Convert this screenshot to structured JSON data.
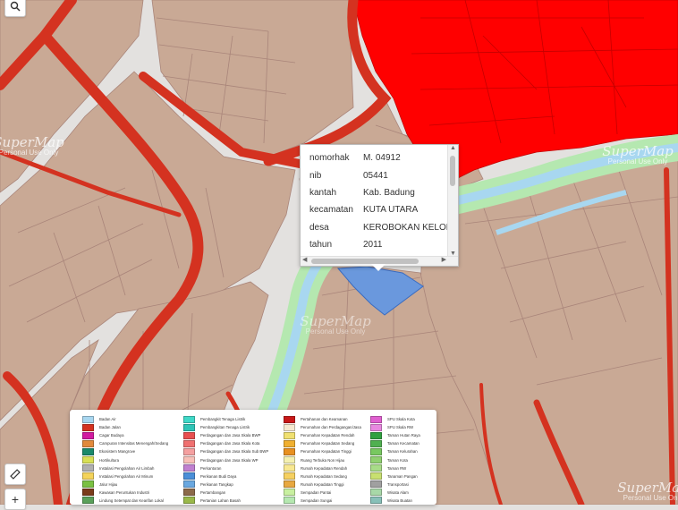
{
  "popup": {
    "rows": [
      {
        "key": "nomorhak",
        "value": "M. 04912"
      },
      {
        "key": "nib",
        "value": "05441"
      },
      {
        "key": "kantah",
        "value": "Kab. Badung"
      },
      {
        "key": "kecamatan",
        "value": "KUTA UTARA"
      },
      {
        "key": "desa",
        "value": "KEROBOKAN KELOD"
      },
      {
        "key": "tahun",
        "value": "2011"
      }
    ]
  },
  "controls": {
    "search_icon": "search-icon",
    "ruler_icon": "ruler-icon",
    "zoom_in_label": "+"
  },
  "watermark": {
    "brand": "SuperMap",
    "note": "Personal Use Only"
  },
  "colors": {
    "land": "#c9a995",
    "road": "#d43220",
    "commercial": "#ff0000",
    "river_buffer": "#b5e8b0",
    "river": "#a8d7f0",
    "selected_parcel": "#6a98dd"
  },
  "legend": {
    "col1": [
      {
        "label": "Badan Air",
        "color": "#a8d7f0"
      },
      {
        "label": "Badan Jalan",
        "color": "#d43220"
      },
      {
        "label": "Cagar Budaya",
        "color": "#d21aa0"
      },
      {
        "label": "Campuran Intensitas Menengah/Sedang",
        "color": "#e28a3c"
      },
      {
        "label": "Ekosistem Mangrove",
        "color": "#1a8a6a"
      },
      {
        "label": "Hortikultura",
        "color": "#d8e055"
      },
      {
        "label": "Instalasi Pengolahan Air Limbah",
        "color": "#b0b0b0"
      },
      {
        "label": "Instalasi Pengolahan Air Minum",
        "color": "#f4d35a"
      },
      {
        "label": "Jalur Hijau",
        "color": "#7ac142"
      },
      {
        "label": "Kawasan Peruntukan Industri",
        "color": "#7a3b1a"
      },
      {
        "label": "Lindung Setempat dan Kearifan Lokal",
        "color": "#5aa05a"
      }
    ],
    "col2": [
      {
        "label": "Pembangkit Tenaga Listrik",
        "color": "#3fd9c8"
      },
      {
        "label": "Pembangkitan Tenaga Listrik",
        "color": "#2ec4b6"
      },
      {
        "label": "Perdagangan dan Jasa Skala BWP",
        "color": "#e85050"
      },
      {
        "label": "Perdagangan dan Jasa Skala Kota",
        "color": "#f07070"
      },
      {
        "label": "Perdagangan dan Jasa Skala Sub BWP",
        "color": "#f5a0a0"
      },
      {
        "label": "Perdagangan dan Jasa Skala WP",
        "color": "#f8c0b8"
      },
      {
        "label": "Perkantoran",
        "color": "#c080d0"
      },
      {
        "label": "Perikanan Budi Daya",
        "color": "#4a8fd8"
      },
      {
        "label": "Perikanan Tangkap",
        "color": "#6aa8e0"
      },
      {
        "label": "Pertambangan",
        "color": "#8c6a4a"
      },
      {
        "label": "Pertanian Lahan Basah",
        "color": "#9ab84a"
      }
    ],
    "col3": [
      {
        "label": "Pertahanan dan Keamanan",
        "color": "#c81818"
      },
      {
        "label": "Perumahan dan Perdagangan/Jasa",
        "color": "#f6e8d0"
      },
      {
        "label": "Perumahan Kepadatan Rendah",
        "color": "#f0e070"
      },
      {
        "label": "Perumahan Kepadatan Sedang",
        "color": "#f0b030"
      },
      {
        "label": "Perumahan Kepadatan Tinggi",
        "color": "#e89020"
      },
      {
        "label": "Ruang Terbuka Non Hijau",
        "color": "#f4f0b0"
      },
      {
        "label": "Rumah Kepadatan Rendah",
        "color": "#f8e890"
      },
      {
        "label": "Rumah Kepadatan Sedang",
        "color": "#f6d060"
      },
      {
        "label": "Rumah Kepadatan Tinggi",
        "color": "#e8a840"
      },
      {
        "label": "Sempadan Pantai",
        "color": "#c8f0a0"
      },
      {
        "label": "Sempadan Sungai",
        "color": "#b5e8b0"
      }
    ],
    "col4": [
      {
        "label": "SPU Skala Kota",
        "color": "#e060d0"
      },
      {
        "label": "SPU Skala RW",
        "color": "#e888e0"
      },
      {
        "label": "Taman Hutan Raya",
        "color": "#30a040"
      },
      {
        "label": "Taman Kecamatan",
        "color": "#50b050"
      },
      {
        "label": "Taman Kelurahan",
        "color": "#78c860"
      },
      {
        "label": "Taman Kota",
        "color": "#90d070"
      },
      {
        "label": "Taman RW",
        "color": "#a8dc88"
      },
      {
        "label": "Tanaman Pangan",
        "color": "#c8e070"
      },
      {
        "label": "Transportasi",
        "color": "#a0a0a0"
      },
      {
        "label": "Wisata Alam",
        "color": "#a8d8a8"
      },
      {
        "label": "Wisata Buatan",
        "color": "#88c0b8"
      }
    ]
  }
}
